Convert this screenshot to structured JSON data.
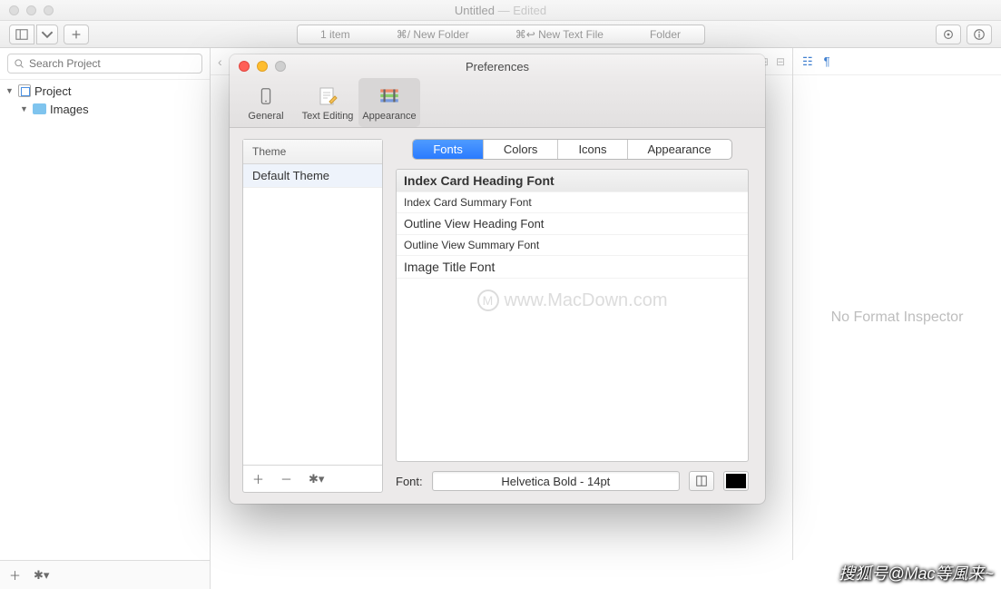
{
  "window": {
    "title": "Untitled",
    "edited": "— Edited"
  },
  "toolbar": {
    "pathbar_item": "1 item",
    "pathbar_new_folder": "⌘/ New Folder",
    "pathbar_new_text": "⌘↩︎ New Text File",
    "pathbar_folder": "Folder"
  },
  "search": {
    "placeholder": "Search Project"
  },
  "tree": {
    "project": "Project",
    "images": "Images"
  },
  "inspector": {
    "empty": "No Format Inspector"
  },
  "pref": {
    "title": "Preferences",
    "toolbar": {
      "general": "General",
      "text_editing": "Text Editing",
      "appearance": "Appearance"
    },
    "theme_header": "Theme",
    "theme_item": "Default Theme",
    "segments": {
      "fonts": "Fonts",
      "colors": "Colors",
      "icons": "Icons",
      "appearance": "Appearance"
    },
    "font_rows": {
      "r0": "Index Card Heading Font",
      "r1": "Index Card Summary Font",
      "r2": "Outline View Heading Font",
      "r3": "Outline View Summary Font",
      "r4": "Image Title Font"
    },
    "font_label": "Font:",
    "font_value": "Helvetica Bold - 14pt",
    "watermark": "www.MacDown.com"
  },
  "overlay": "搜狐号@Mac等風来~"
}
